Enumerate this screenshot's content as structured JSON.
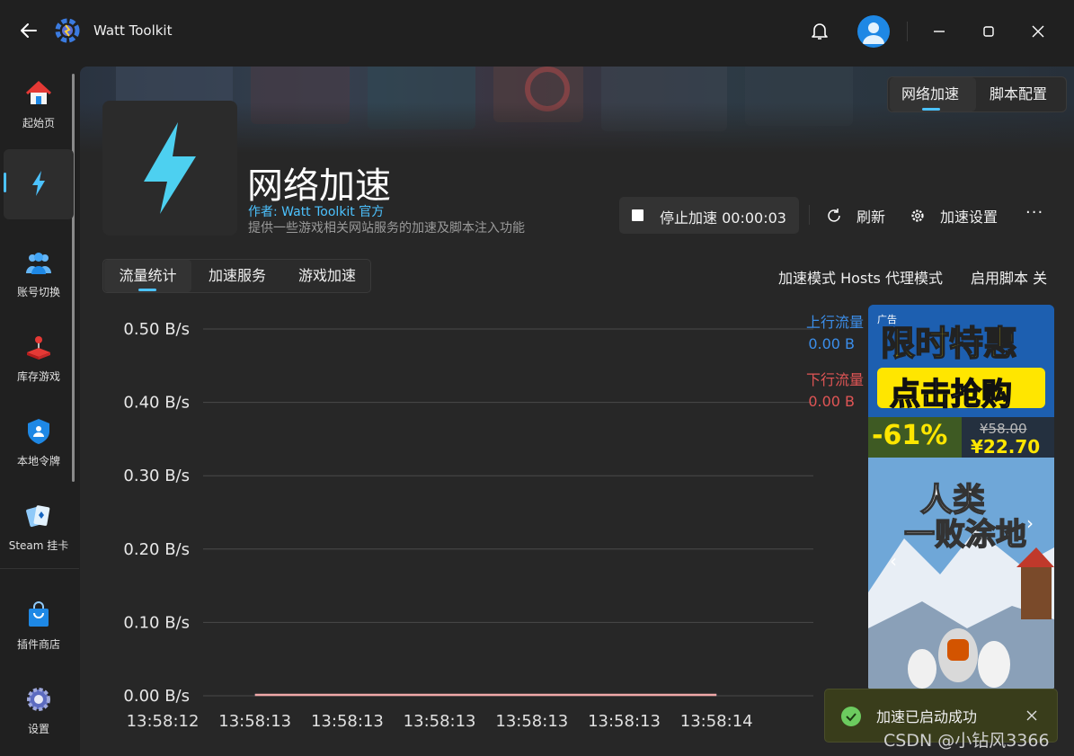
{
  "app": {
    "title": "Watt Toolkit"
  },
  "sidebar": {
    "items": [
      {
        "label": "起始页",
        "icon": "home-icon"
      },
      {
        "label": "",
        "icon": "lightning-icon",
        "active": true
      },
      {
        "label": "账号切换",
        "icon": "users-icon"
      },
      {
        "label": "库存游戏",
        "icon": "joystick-icon"
      },
      {
        "label": "本地令牌",
        "icon": "shield-icon"
      },
      {
        "label": "Steam 挂卡",
        "icon": "cards-icon"
      },
      {
        "label": "插件商店",
        "icon": "shopping-bag-icon"
      },
      {
        "label": "设置",
        "icon": "gear-icon"
      }
    ]
  },
  "top_tabs": [
    {
      "label": "网络加速",
      "active": true
    },
    {
      "label": "脚本配置",
      "active": false
    }
  ],
  "plugin": {
    "title": "网络加速",
    "author": "作者:  Watt Toolkit  官方",
    "description": "提供一些游戏相关网站服务的加速及脚本注入功能"
  },
  "actions": {
    "stop_label": "停止加速 00:00:03",
    "refresh_label": "刷新",
    "settings_label": "加速设置",
    "more_label": "···"
  },
  "sub_tabs": [
    {
      "label": "流量统计",
      "active": true
    },
    {
      "label": "加速服务",
      "active": false
    },
    {
      "label": "游戏加速",
      "active": false
    }
  ],
  "status": {
    "mode": "加速模式 Hosts 代理模式",
    "script": "启用脚本 关"
  },
  "chart_data": {
    "type": "line",
    "y_ticks": [
      "0.50 B/s",
      "0.40 B/s",
      "0.30 B/s",
      "0.20 B/s",
      "0.10 B/s",
      "0.00 B/s"
    ],
    "ylim": [
      0,
      0.5
    ],
    "x": [
      "13:58:12",
      "13:58:13",
      "13:58:13",
      "13:58:13",
      "13:58:13",
      "13:58:13",
      "13:58:14"
    ],
    "series": [
      {
        "name": "上行流量",
        "value_label": "0.00 B",
        "color": "#3b8eea",
        "values": [
          0,
          0,
          0,
          0,
          0,
          0,
          0
        ]
      },
      {
        "name": "下行流量",
        "value_label": "0.00 B",
        "color": "#e05555",
        "values": [
          0,
          0,
          0,
          0,
          0,
          0,
          0
        ]
      }
    ],
    "grid": true,
    "legend": "top-right"
  },
  "ad": {
    "label": "广告",
    "headline": "限时特惠",
    "cta": "点击抢购",
    "discount": "-61%",
    "old_price": "¥58.00",
    "new_price": "¥22.70",
    "game_title_1": "人类",
    "game_title_2": "一败涂地"
  },
  "toast": {
    "message": "加速已启动成功"
  },
  "watermark": "CSDN @小钻风3366"
}
